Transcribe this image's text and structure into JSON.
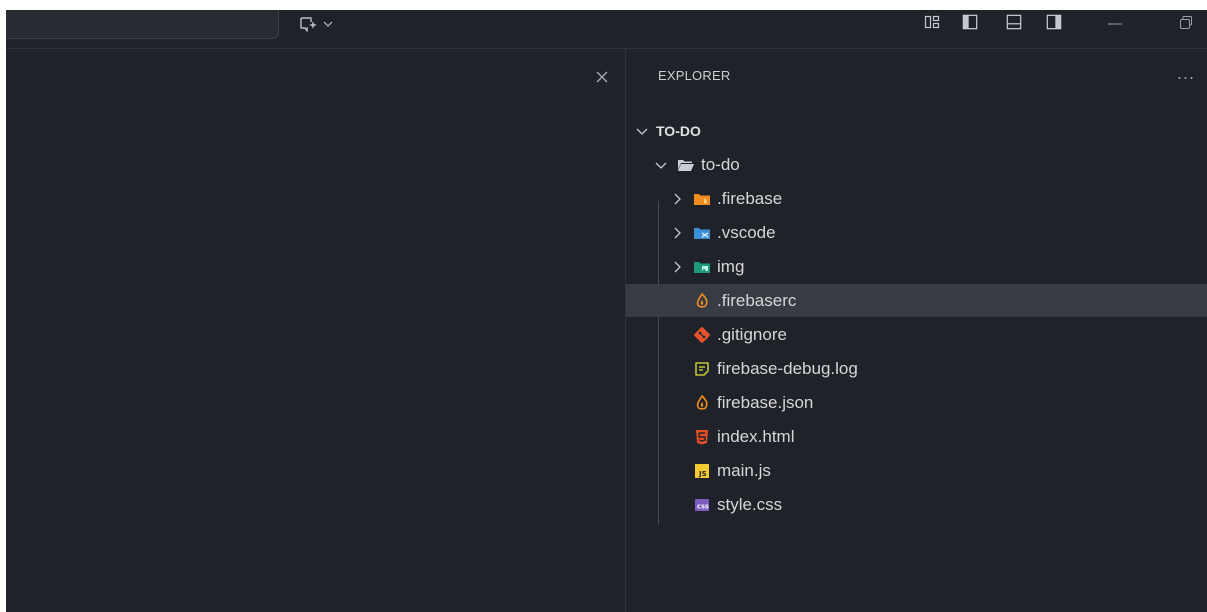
{
  "explorer": {
    "title": "EXPLORER",
    "more_label": "...",
    "root": {
      "label": "TO-DO"
    },
    "folder": {
      "label": "to-do"
    },
    "items": [
      {
        "label": ".firebase",
        "kind": "folder",
        "icon": "firebase-folder-icon",
        "color": "#f08d1e"
      },
      {
        "label": ".vscode",
        "kind": "folder",
        "icon": "vscode-folder-icon",
        "color": "#3c8fd6"
      },
      {
        "label": "img",
        "kind": "folder",
        "icon": "img-folder-icon",
        "color": "#1f9a7b"
      },
      {
        "label": ".firebaserc",
        "kind": "file",
        "icon": "firebase-icon",
        "color": "#f08d1e",
        "selected": true
      },
      {
        "label": ".gitignore",
        "kind": "file",
        "icon": "git-icon",
        "color": "#e5532d"
      },
      {
        "label": "firebase-debug.log",
        "kind": "file",
        "icon": "log-file-icon",
        "color": "#c0c238"
      },
      {
        "label": "firebase.json",
        "kind": "file",
        "icon": "firebase-icon",
        "color": "#f08d1e"
      },
      {
        "label": "index.html",
        "kind": "file",
        "icon": "html-icon",
        "color": "#e44d26"
      },
      {
        "label": "main.js",
        "kind": "file",
        "icon": "js-icon",
        "color": "#f2cb30"
      },
      {
        "label": "style.css",
        "kind": "file",
        "icon": "css-icon",
        "color": "#7d5dbf"
      }
    ]
  },
  "colors": {
    "background": "#1f2228",
    "selected_row": "#373b43",
    "text": "#d6d6d6"
  }
}
